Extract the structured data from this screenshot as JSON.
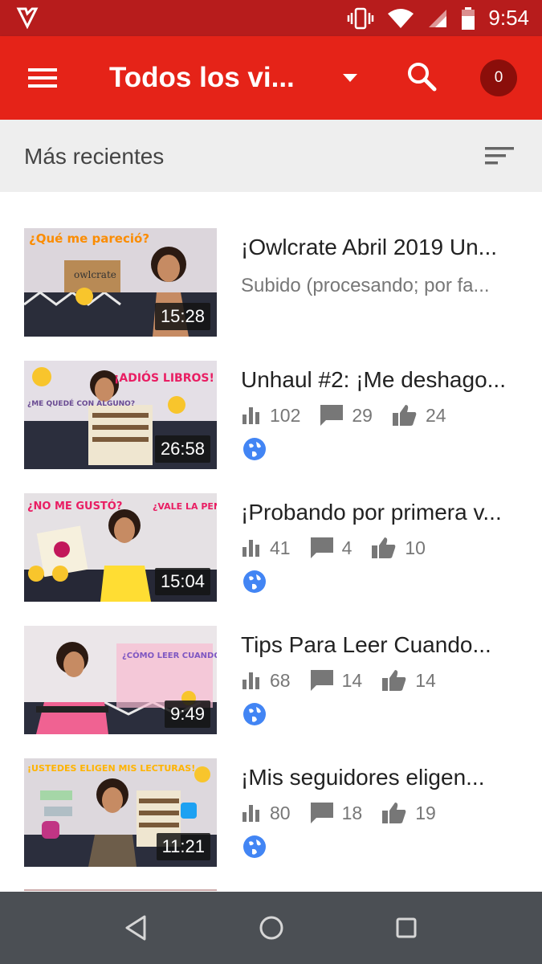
{
  "status_bar": {
    "time": "9:54"
  },
  "toolbar": {
    "title": "Todos los vi...",
    "notifications": "0"
  },
  "sort": {
    "label": "Más recientes"
  },
  "videos": [
    {
      "title": "¡Owlcrate Abril 2019 Un...",
      "subtitle": "Subido (procesando; por fa...",
      "duration": "15:28",
      "thumb_text": "¿Qué me pareció?",
      "thumb_extra": "owlcrate"
    },
    {
      "title": "Unhaul #2: ¡Me deshago...",
      "views": "102",
      "comments": "29",
      "likes": "24",
      "duration": "26:58",
      "thumb_text": "¡ADIÓS LIBROS!",
      "thumb_extra": "¿ME QUEDÉ CON ALGUNO?"
    },
    {
      "title": "¡Probando por primera v...",
      "views": "41",
      "comments": "4",
      "likes": "10",
      "duration": "15:04",
      "thumb_text": "¿NO ME GUSTÓ?",
      "thumb_extra": "¿VALE LA PENA?"
    },
    {
      "title": "Tips Para Leer Cuando...",
      "views": "68",
      "comments": "14",
      "likes": "14",
      "duration": "9:49",
      "thumb_text": "¿CÓMO LEER CUANDO NO TENEMOS TIEMPO?",
      "thumb_extra": ""
    },
    {
      "title": "¡Mis seguidores eligen...",
      "views": "80",
      "comments": "18",
      "likes": "19",
      "duration": "11:21",
      "thumb_text": "¡USTEDES ELIGEN MIS LECTURAS!",
      "thumb_extra": ""
    }
  ],
  "colors": {
    "status_bar": "#b71c1c",
    "toolbar": "#e52318",
    "notif_badge": "#8b0e0a",
    "globe": "#4285f4",
    "navbar": "#4b4f54"
  },
  "icons": {
    "menu": "hamburger-icon",
    "search": "search-icon",
    "sort": "sort-icon",
    "views": "bar-chart-icon",
    "comments": "comment-icon",
    "likes": "thumb-up-icon",
    "visibility": "globe-icon"
  }
}
